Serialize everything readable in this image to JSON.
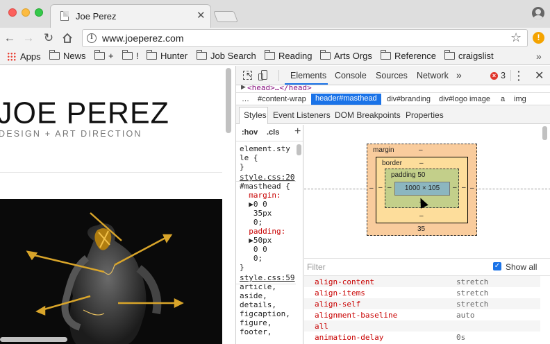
{
  "browser": {
    "tab_title": "Joe Perez",
    "tab_close": "✕",
    "url": "www.joeperez.com",
    "bookmarks": [
      {
        "label": "Apps",
        "kind": "apps"
      },
      {
        "label": "News",
        "kind": "folder"
      },
      {
        "label": "+",
        "kind": "folder"
      },
      {
        "label": "!",
        "kind": "folder"
      },
      {
        "label": "Hunter",
        "kind": "folder"
      },
      {
        "label": "Job Search",
        "kind": "folder"
      },
      {
        "label": "Reading",
        "kind": "folder"
      },
      {
        "label": "Arts Orgs",
        "kind": "folder"
      },
      {
        "label": "Reference",
        "kind": "folder"
      },
      {
        "label": "craigslist",
        "kind": "folder"
      }
    ],
    "bookmarks_more": "»",
    "extension_badge": "!"
  },
  "site": {
    "title": "JOE PEREZ",
    "subtitle": "DESIGN + ART DIRECTION"
  },
  "devtools": {
    "tabs": [
      "Elements",
      "Console",
      "Sources",
      "Network"
    ],
    "more_tabs": "»",
    "error_count": "3",
    "dom_line": "<head>…</head>",
    "breadcrumbs": [
      "…",
      "#content-wrap",
      "header#masthead",
      "div#branding",
      "div#logo image",
      "a",
      "img"
    ],
    "active_crumb": "header#masthead",
    "sub_tabs": [
      "Styles",
      "Event Listeners",
      "DOM Breakpoints",
      "Properties"
    ],
    "styles_toolbar": {
      "hov": ":hov",
      "cls": ".cls",
      "add": "+"
    },
    "styles_lines": [
      {
        "text": "element.sty",
        "cls": ""
      },
      {
        "text": "le {",
        "cls": ""
      },
      {
        "text": "}",
        "cls": ""
      },
      {
        "text": "style.css:20",
        "cls": "src"
      },
      {
        "text": "#masthead {",
        "cls": ""
      },
      {
        "text": "  margin:",
        "cls": "prop"
      },
      {
        "text": "  ▶0 0",
        "cls": ""
      },
      {
        "text": "   35px",
        "cls": ""
      },
      {
        "text": "   0;",
        "cls": ""
      },
      {
        "text": "  padding:",
        "cls": "prop"
      },
      {
        "text": "  ▶50px",
        "cls": ""
      },
      {
        "text": "   0 0",
        "cls": ""
      },
      {
        "text": "   0;",
        "cls": ""
      },
      {
        "text": "}",
        "cls": ""
      },
      {
        "text": "style.css:59",
        "cls": "src"
      },
      {
        "text": "article,",
        "cls": ""
      },
      {
        "text": "aside,",
        "cls": ""
      },
      {
        "text": "details,",
        "cls": ""
      },
      {
        "text": "figcaption,",
        "cls": ""
      },
      {
        "text": "figure,",
        "cls": ""
      },
      {
        "text": "footer,",
        "cls": ""
      }
    ],
    "box_model": {
      "margin_label": "margin",
      "margin_top": "–",
      "margin_bottom": "35",
      "margin_left": "–",
      "margin_right": "–",
      "border_label": "border",
      "border_top": "–",
      "border_bottom": "–",
      "border_left": "–",
      "border_right": "–",
      "padding_label": "padding 50",
      "padding_bottom": "–",
      "padding_left": "–",
      "padding_right": "–",
      "content": "1000 × 105"
    },
    "computed": {
      "filter_placeholder": "Filter",
      "show_all_label": "Show all",
      "show_all_checked": true,
      "rows": [
        {
          "prop": "align-content",
          "value": "stretch"
        },
        {
          "prop": "align-items",
          "value": "stretch"
        },
        {
          "prop": "align-self",
          "value": "stretch"
        },
        {
          "prop": "alignment-baseline",
          "value": "auto"
        },
        {
          "prop": "all",
          "value": ""
        },
        {
          "prop": "animation-delay",
          "value": "0s"
        }
      ]
    }
  },
  "colors": {
    "accent": "#1a73e8",
    "margin_fill": "#f9cc9d",
    "border_fill": "#fddd9b",
    "padding_fill": "#c3cf8a",
    "content_fill": "#8cb6c0",
    "css_property": "#c80000"
  }
}
